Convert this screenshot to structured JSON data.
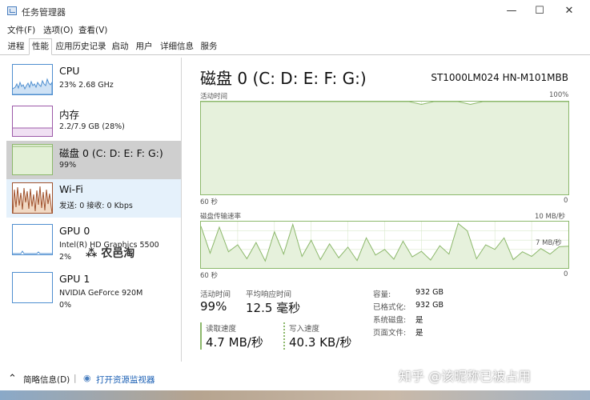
{
  "window": {
    "title": "任务管理器",
    "minimize": "—",
    "maximize": "☐",
    "close": "✕"
  },
  "menu": [
    "文件(F)",
    "选项(O)",
    "查看(V)"
  ],
  "tabs": [
    "进程",
    "性能",
    "应用历史记录",
    "启动",
    "用户",
    "详细信息",
    "服务"
  ],
  "active_tab": "性能",
  "sidebar": {
    "items": [
      {
        "name": "CPU",
        "sub": "23% 2.68 GHz",
        "sub2": ""
      },
      {
        "name": "内存",
        "sub": "2.2/7.9 GB (28%)",
        "sub2": ""
      },
      {
        "name": "磁盘 0 (C: D: E: F: G:)",
        "sub": "99%",
        "sub2": ""
      },
      {
        "name": "Wi-Fi",
        "sub": "发送: 0 接收: 0 Kbps",
        "sub2": ""
      },
      {
        "name": "GPU 0",
        "sub": "Intel(R) HD Graphics 5500",
        "sub2": "2%"
      },
      {
        "name": "GPU 1",
        "sub": "NVIDIA GeForce 920M",
        "sub2": "0%"
      }
    ]
  },
  "main": {
    "title": "磁盘 0 (C: D: E: F: G:)",
    "model": "ST1000LM024 HN-M101MBB",
    "chart1": {
      "label": "活动时间",
      "max_label": "100%",
      "time_label": "60 秒",
      "min_label": "0"
    },
    "chart2": {
      "label": "磁盘传输速率",
      "max_label": "10 MB/秒",
      "mid_label": "7 MB/秒",
      "time_label": "60 秒",
      "min_label": "0"
    },
    "stats": {
      "active_time_label": "活动时间",
      "active_time_value": "99%",
      "avg_response_label": "平均响应时间",
      "avg_response_value": "12.5 毫秒",
      "read_label": "读取速度",
      "read_value": "4.7 MB/秒",
      "write_label": "写入速度",
      "write_value": "40.3 KB/秒"
    },
    "props": [
      {
        "label": "容量:",
        "value": "932 GB"
      },
      {
        "label": "已格式化:",
        "value": "932 GB"
      },
      {
        "label": "系统磁盘:",
        "value": "是"
      },
      {
        "label": "页面文件:",
        "value": "是"
      }
    ]
  },
  "footer": {
    "summary": "简略信息(D)",
    "monitor": "打开资源监视器"
  },
  "watermark": {
    "brand": "农邑淘",
    "zhihu": "知乎 @该昵称已被占用"
  },
  "colors": {
    "disk_green": "#8cb86b",
    "wifi_orange": "#a0522d",
    "cpu_blue": "#4f8fd0",
    "mem_purple": "#9c5aa8"
  },
  "chart_data": [
    {
      "type": "area",
      "title": "活动时间",
      "ylim": [
        0,
        100
      ],
      "x": [
        0,
        1,
        2,
        3,
        4,
        5,
        6,
        7,
        8,
        9,
        10,
        11,
        12,
        13,
        14,
        15,
        16,
        17,
        18,
        19,
        20,
        21,
        22,
        23,
        24,
        25,
        26,
        27,
        28,
        29,
        30
      ],
      "values": [
        100,
        100,
        100,
        100,
        100,
        100,
        100,
        100,
        100,
        100,
        100,
        100,
        100,
        100,
        100,
        100,
        100,
        100,
        97,
        100,
        100,
        100,
        97,
        100,
        100,
        100,
        100,
        100,
        100,
        100,
        100
      ]
    },
    {
      "type": "area",
      "title": "磁盘传输速率",
      "ylim": [
        0,
        10
      ],
      "x": [
        0,
        1,
        2,
        3,
        4,
        5,
        6,
        7,
        8,
        9,
        10,
        11,
        12,
        13,
        14,
        15,
        16,
        17,
        18,
        19,
        20,
        21,
        22,
        23,
        24,
        25,
        26,
        27,
        28,
        29,
        30,
        31,
        32,
        33,
        34,
        35,
        36,
        37,
        38,
        39,
        40
      ],
      "values": [
        9.0,
        3.2,
        8.8,
        3.5,
        5.0,
        2.0,
        5.5,
        1.5,
        7.8,
        3.0,
        9.4,
        2.5,
        6.0,
        1.8,
        5.2,
        2.2,
        4.5,
        1.6,
        6.5,
        2.8,
        4.0,
        1.9,
        5.8,
        2.4,
        3.6,
        1.7,
        4.8,
        3.0,
        9.6,
        8.0,
        2.0,
        5.0,
        4.0,
        6.5,
        1.8,
        3.5,
        2.5,
        4.2,
        3.0,
        4.6,
        4.7
      ]
    }
  ]
}
